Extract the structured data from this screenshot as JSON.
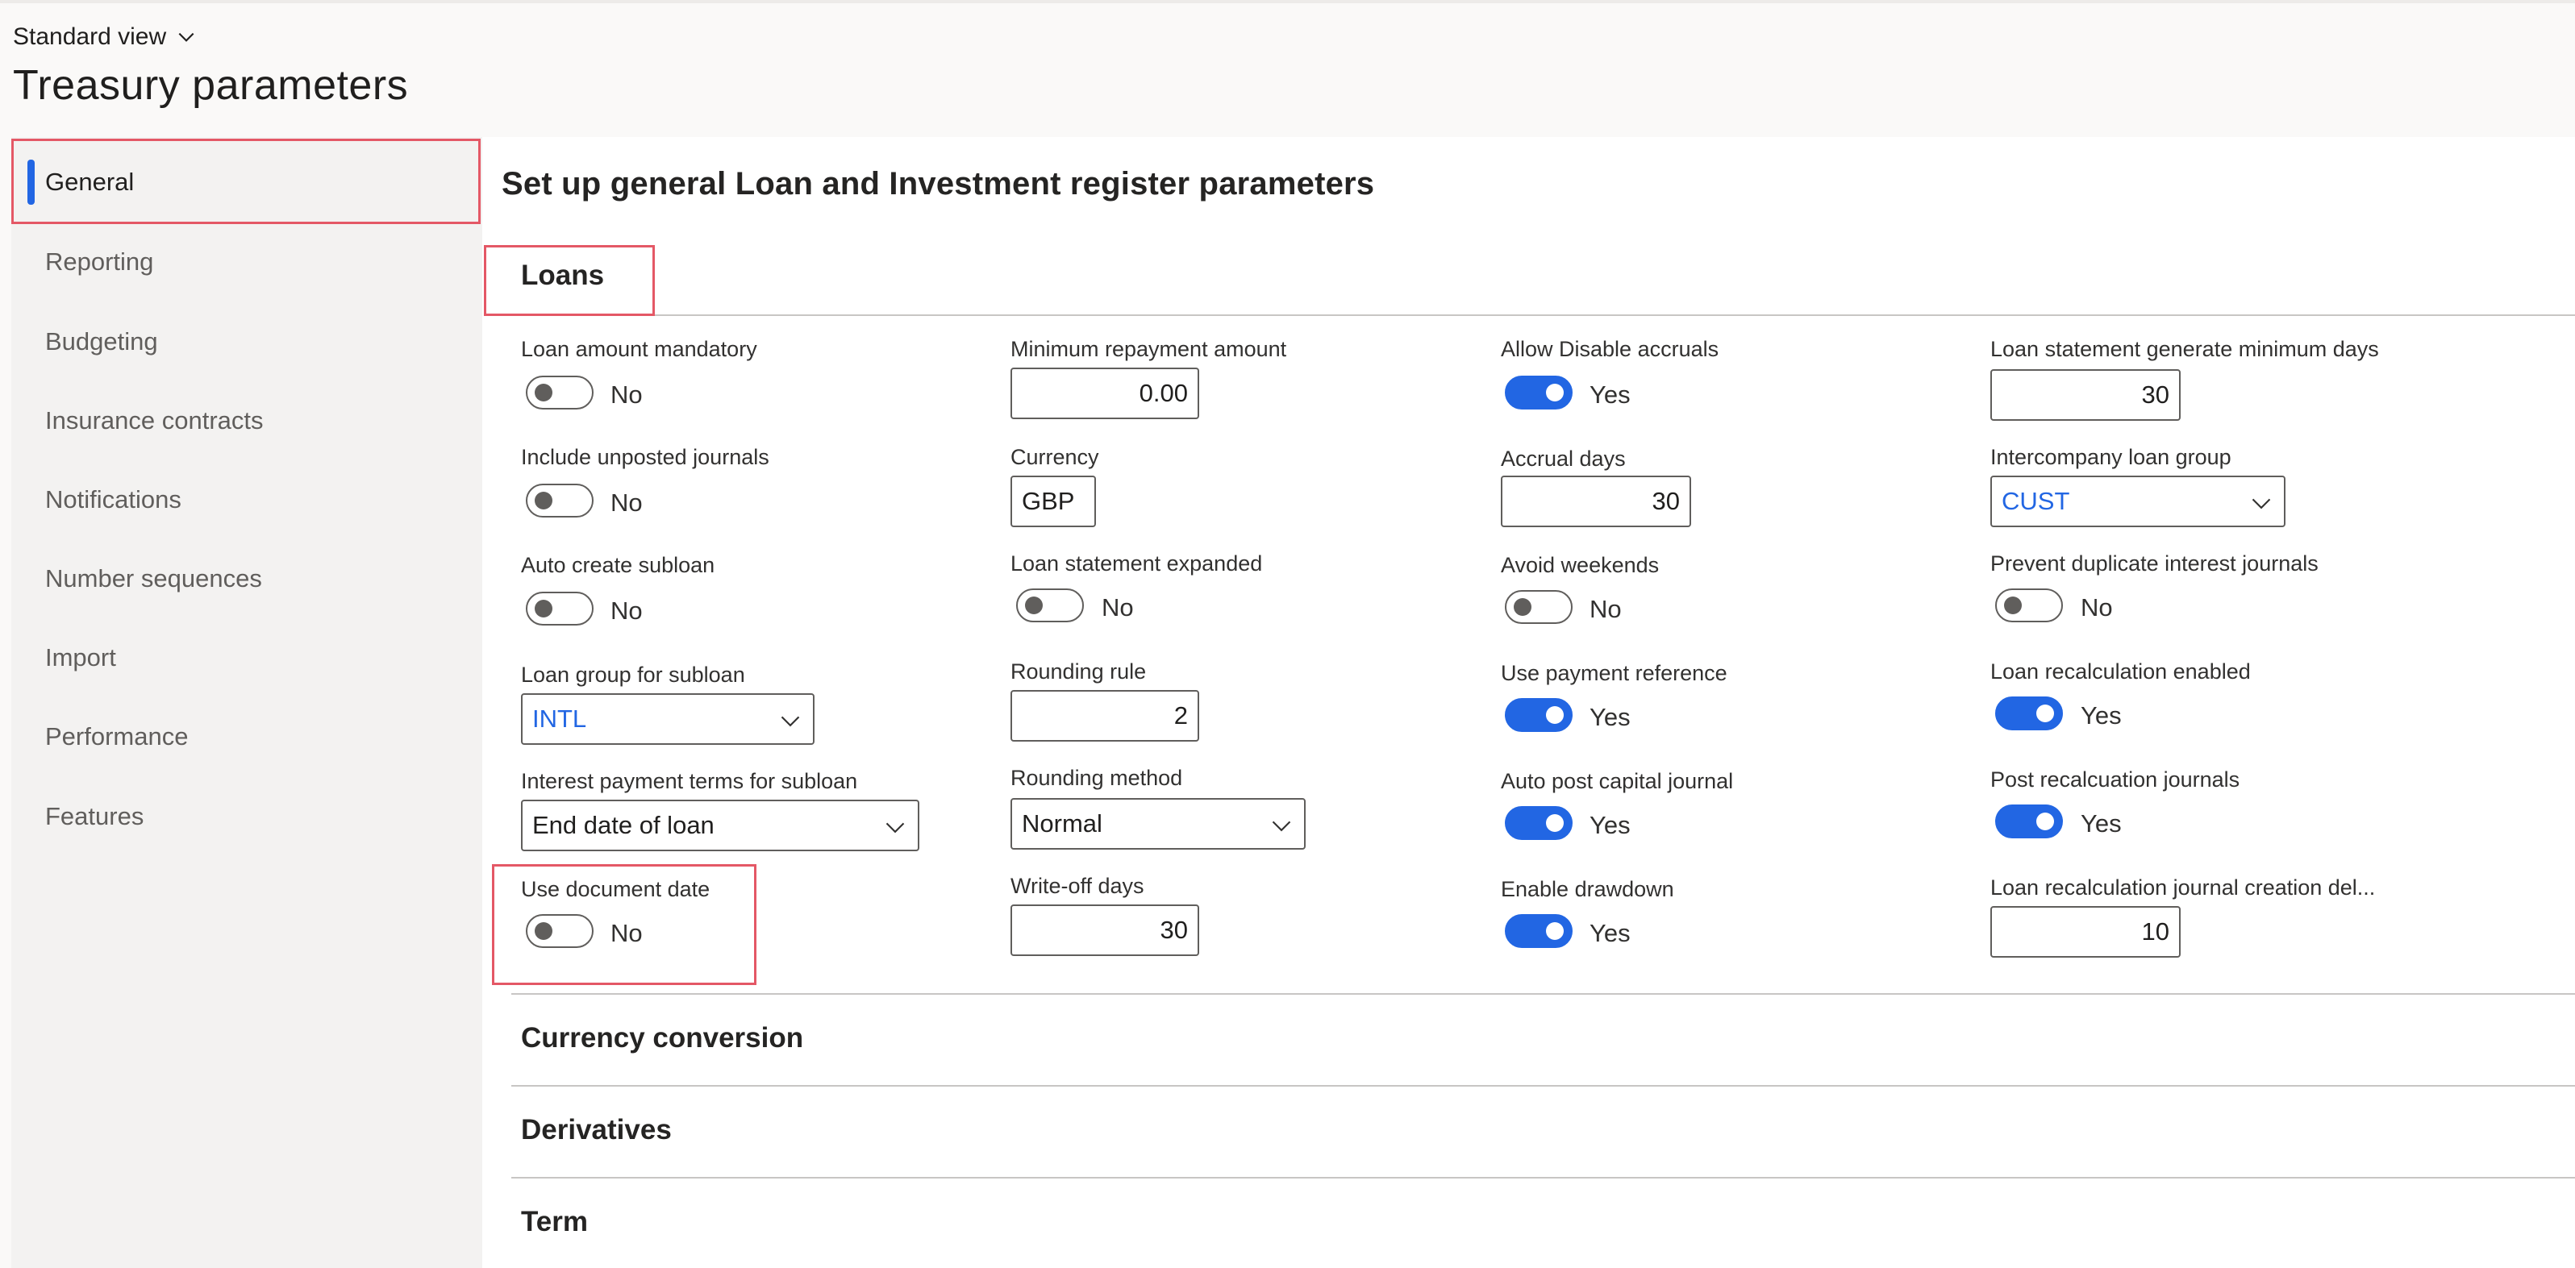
{
  "header": {
    "view_label": "Standard view",
    "title": "Treasury parameters"
  },
  "nav": {
    "items": [
      {
        "label": "General",
        "selected": true
      },
      {
        "label": "Reporting"
      },
      {
        "label": "Budgeting"
      },
      {
        "label": "Insurance contracts"
      },
      {
        "label": "Notifications"
      },
      {
        "label": "Number sequences"
      },
      {
        "label": "Import"
      },
      {
        "label": "Performance"
      },
      {
        "label": "Features"
      }
    ]
  },
  "content": {
    "section_title": "Set up general Loan and Investment register parameters",
    "tabs": {
      "loans": "Loans",
      "currency_conversion": "Currency conversion",
      "derivatives": "Derivatives",
      "term": "Term"
    },
    "fields": {
      "loan_amount_mandatory": {
        "label": "Loan amount mandatory",
        "value": "No"
      },
      "include_unposted_journals": {
        "label": "Include unposted journals",
        "value": "No"
      },
      "auto_create_subloan": {
        "label": "Auto create subloan",
        "value": "No"
      },
      "loan_group_for_subloan": {
        "label": "Loan group for subloan",
        "value": "INTL"
      },
      "interest_payment_terms": {
        "label": "Interest payment terms for subloan",
        "value": "End date of loan"
      },
      "use_document_date": {
        "label": "Use document date",
        "value": "No"
      },
      "minimum_repayment_amount": {
        "label": "Minimum repayment amount",
        "value": "0.00"
      },
      "currency": {
        "label": "Currency",
        "value": "GBP"
      },
      "loan_statement_expanded": {
        "label": "Loan statement expanded",
        "value": "No"
      },
      "rounding_rule": {
        "label": "Rounding rule",
        "value": "2"
      },
      "rounding_method": {
        "label": "Rounding method",
        "value": "Normal"
      },
      "write_off_days": {
        "label": "Write-off days",
        "value": "30"
      },
      "allow_disable_accruals": {
        "label": "Allow Disable accruals",
        "value": "Yes"
      },
      "accrual_days": {
        "label": "Accrual days",
        "value": "30"
      },
      "avoid_weekends": {
        "label": "Avoid weekends",
        "value": "No"
      },
      "use_payment_reference": {
        "label": "Use payment reference",
        "value": "Yes"
      },
      "auto_post_capital_journal": {
        "label": "Auto post capital journal",
        "value": "Yes"
      },
      "enable_drawdown": {
        "label": "Enable drawdown",
        "value": "Yes"
      },
      "loan_statement_min_days": {
        "label": "Loan statement generate minimum days",
        "value": "30"
      },
      "intercompany_loan_group": {
        "label": "Intercompany loan group",
        "value": "CUST"
      },
      "prevent_duplicate_interest": {
        "label": "Prevent duplicate interest journals",
        "value": "No"
      },
      "loan_recalc_enabled": {
        "label": "Loan recalculation enabled",
        "value": "Yes"
      },
      "post_recalc_journals": {
        "label": "Post recalcuation journals",
        "value": "Yes"
      },
      "loan_recalc_creation_delay": {
        "label": "Loan recalculation journal creation del...",
        "value": "10"
      }
    }
  },
  "colors": {
    "accent": "#2266e3",
    "highlight_box": "#e45866"
  }
}
